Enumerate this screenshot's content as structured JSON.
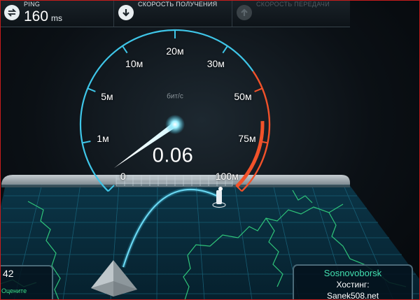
{
  "topbar": {
    "ping": {
      "label": "PING",
      "value": "160",
      "unit": "ms",
      "icon": "ping-icon"
    },
    "download": {
      "label": "СКОРОСТЬ ПОЛУЧЕНИЯ",
      "icon": "arrow-down-icon"
    },
    "upload": {
      "label": "СКОРОСТЬ ПЕРЕДАЧИ",
      "icon": "arrow-up-icon"
    }
  },
  "gauge": {
    "unit": "бит/с",
    "value": "0.06",
    "needle_value": 0.06,
    "scale": [
      "0",
      "1м",
      "5м",
      "10м",
      "20м",
      "30м",
      "50м",
      "75м",
      "100м"
    ]
  },
  "server": {
    "city": "Sosnovoborsk",
    "host_label": "Хостинг:",
    "host_name": "Sanek508.net"
  },
  "left_panel": {
    "number": "42",
    "rate_label": "Оцените"
  },
  "colors": {
    "accent_blue": "#3fc6e8",
    "hot_orange": "#f2522a",
    "grid": "#1d6f87",
    "border": "#c61c1c"
  }
}
